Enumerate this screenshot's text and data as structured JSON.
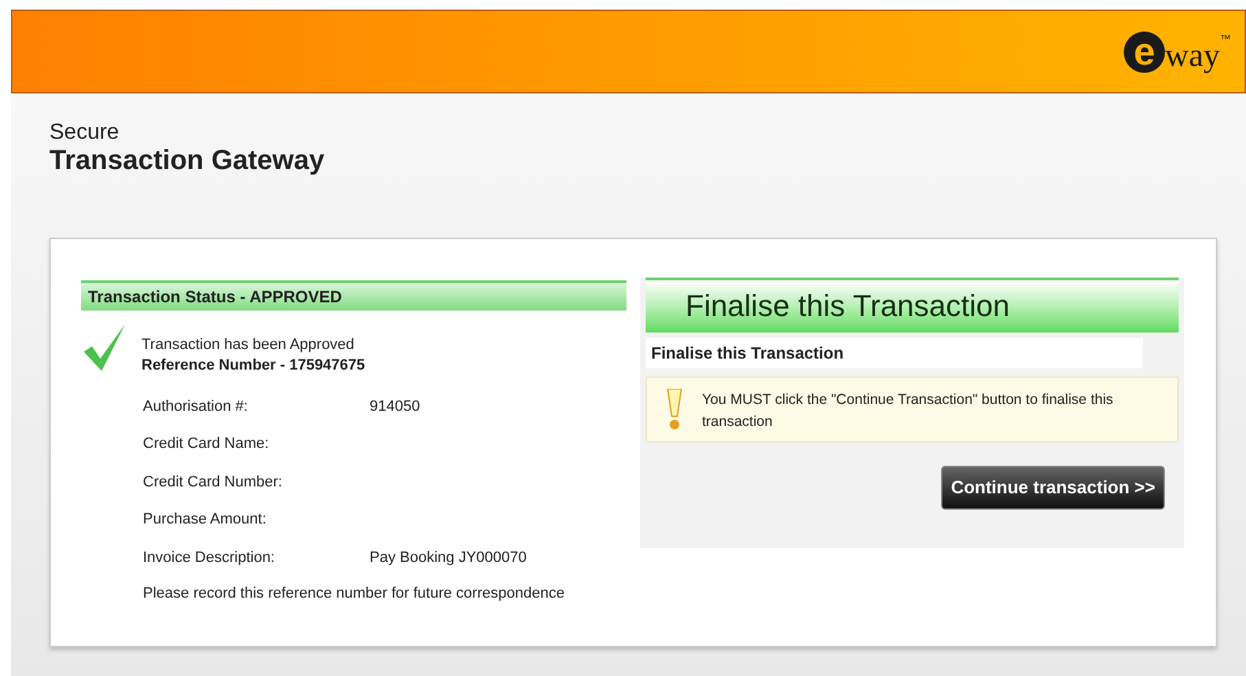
{
  "header": {
    "logo": {
      "letter": "e",
      "text": "way",
      "mark": "™"
    }
  },
  "title": {
    "line_1": "Secure",
    "line_2": "Transaction Gateway"
  },
  "status": {
    "heading": "Transaction Status - APPROVED",
    "message": "Transaction has been Approved",
    "reference": "Reference Number - 175947675",
    "fields": [
      {
        "label": "Authorisation #:",
        "value": "914050"
      },
      {
        "label": "Credit Card Name:"
      },
      {
        "label": "Credit Card Number:"
      },
      {
        "label": "Purchase Amount:"
      },
      {
        "label": "Invoice Description:",
        "value": "Pay Booking JY000070"
      }
    ],
    "note": "Please record this reference number for future correspondence"
  },
  "finalise": {
    "banner": "Finalise this Transaction",
    "subheading": "Finalise this Transaction",
    "warning": "You MUST click the \"Continue Transaction\" button to finalise this transaction",
    "button": "Continue transaction >>"
  }
}
